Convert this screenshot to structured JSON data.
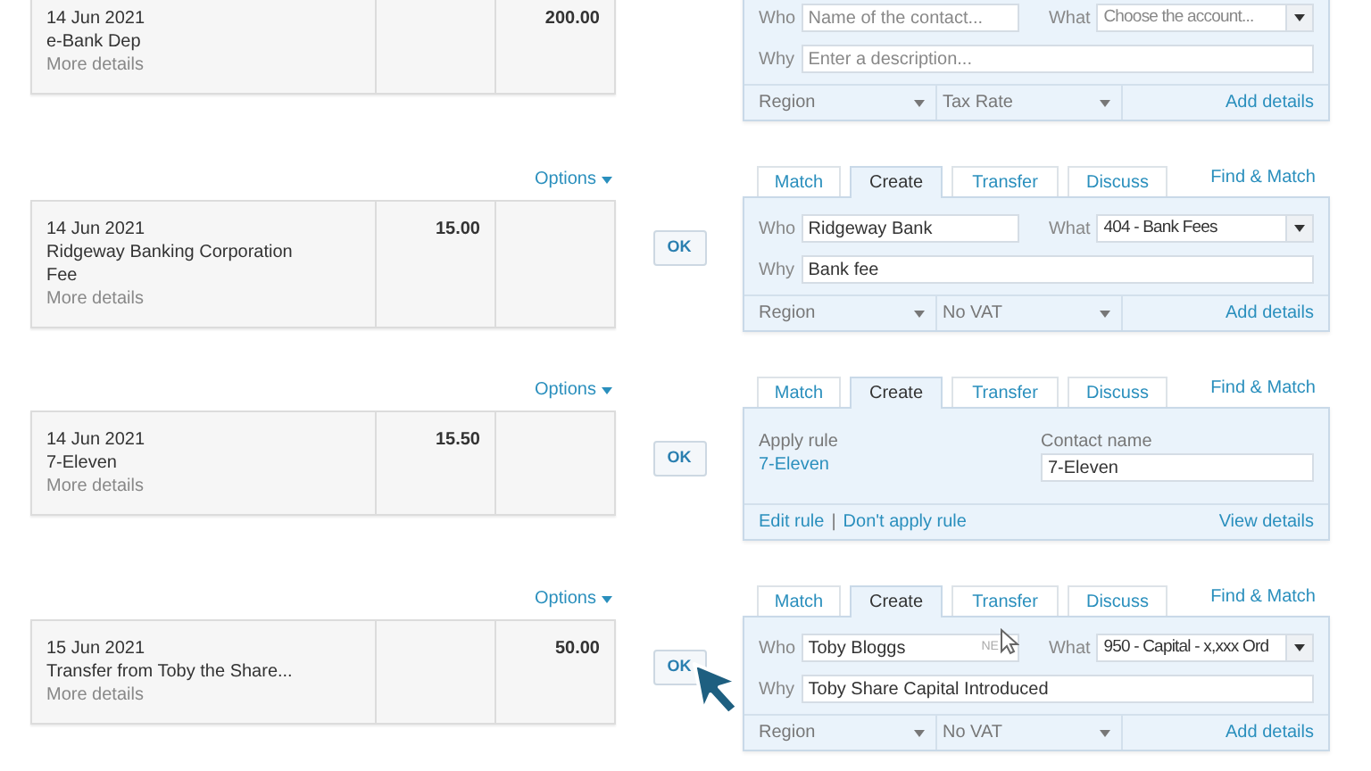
{
  "rows": [
    {
      "date": "14 Jun 2021",
      "description": [
        "e-Bank Dep"
      ],
      "more_details": "More details",
      "received": "200.00",
      "panel": {
        "kind": "coding",
        "who_label": "Who",
        "who": {
          "placeholder": "Name of the contact..."
        },
        "what_label": "What",
        "what": {
          "placeholder": "Choose the account..."
        },
        "why_label": "Why",
        "why": {
          "placeholder": "Enter a description..."
        },
        "region": "Region",
        "tax": "Tax Rate",
        "footer_link": "Add details"
      }
    },
    {
      "options": "Options",
      "date": "14 Jun 2021",
      "description": [
        "Ridgeway Banking Corporation",
        "Fee"
      ],
      "more_details": "More details",
      "spent": "15.00",
      "ok": "OK",
      "tabs": [
        {
          "label": "Match",
          "selected": false
        },
        {
          "label": "Create",
          "selected": true
        },
        {
          "label": "Transfer",
          "selected": false
        },
        {
          "label": "Discuss",
          "selected": false
        }
      ],
      "find_match": "Find & Match",
      "panel": {
        "kind": "coding",
        "who_label": "Who",
        "who": {
          "value": "Ridgeway Bank"
        },
        "what_label": "What",
        "what": {
          "value": "404 - Bank Fees"
        },
        "why_label": "Why",
        "why": {
          "value": "Bank fee"
        },
        "region": "Region",
        "tax": "No VAT",
        "footer_link": "Add details"
      }
    },
    {
      "options": "Options",
      "date": "14 Jun 2021",
      "description": [
        "7-Eleven"
      ],
      "more_details": "More details",
      "spent": "15.50",
      "ok": "OK",
      "tabs": [
        {
          "label": "Match",
          "selected": false
        },
        {
          "label": "Create",
          "selected": true
        },
        {
          "label": "Transfer",
          "selected": false
        },
        {
          "label": "Discuss",
          "selected": false
        }
      ],
      "find_match": "Find & Match",
      "panel": {
        "kind": "rule",
        "apply_rule_label": "Apply rule",
        "rule_name": "7-Eleven",
        "contact_label": "Contact name",
        "contact": {
          "value": "7-Eleven"
        },
        "edit_rule": "Edit rule",
        "separator": "|",
        "dont_apply": "Don't apply rule",
        "footer_link": "View details"
      }
    },
    {
      "options": "Options",
      "date": "15 Jun 2021",
      "description": [
        "Transfer from Toby the Share..."
      ],
      "more_details": "More details",
      "received": "50.00",
      "ok": "OK",
      "tabs": [
        {
          "label": "Match",
          "selected": false
        },
        {
          "label": "Create",
          "selected": true
        },
        {
          "label": "Transfer",
          "selected": false
        },
        {
          "label": "Discuss",
          "selected": false
        }
      ],
      "find_match": "Find & Match",
      "panel": {
        "kind": "coding",
        "who_label": "Who",
        "who": {
          "value": "Toby Bloggs",
          "badge": "NE"
        },
        "what_label": "What",
        "what": {
          "value": "950 - Capital - x,xxx Ord"
        },
        "why_label": "Why",
        "why": {
          "value": "Toby Share Capital Introduced"
        },
        "region": "Region",
        "tax": "No VAT",
        "footer_link": "Add details"
      }
    }
  ]
}
